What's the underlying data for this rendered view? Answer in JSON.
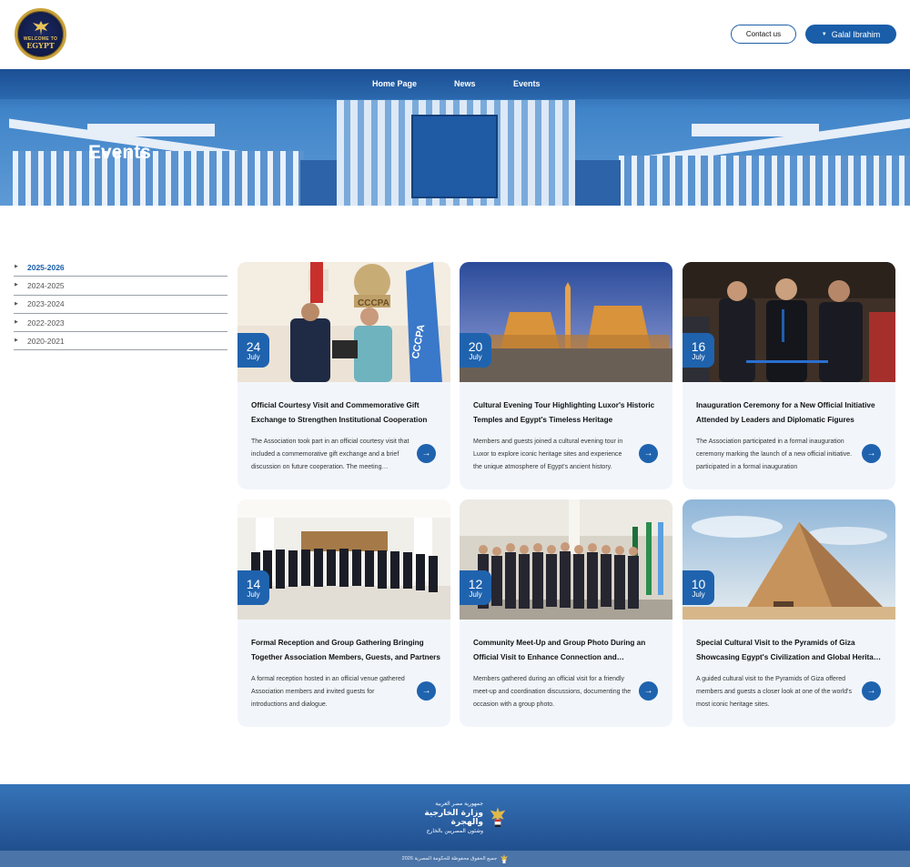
{
  "header": {
    "logo_line1": "WELCOME TO",
    "logo_line2": "EGYPT",
    "contact_label": "Contact us",
    "user_label": "Galal Ibrahim"
  },
  "nav": {
    "items": [
      {
        "label": "Home Page"
      },
      {
        "label": "News"
      },
      {
        "label": "Events"
      }
    ]
  },
  "hero": {
    "title": "Events"
  },
  "sidebar": {
    "items": [
      {
        "label": "2025-2026",
        "active": true
      },
      {
        "label": "2024-2025",
        "active": false
      },
      {
        "label": "2023-2024",
        "active": false
      },
      {
        "label": "2022-2023",
        "active": false
      },
      {
        "label": "2020-2021",
        "active": false
      }
    ]
  },
  "events": [
    {
      "day": "24",
      "month": "July",
      "title": "Official Courtesy Visit and Commemorative Gift Exchange to Strengthen Institutional Cooperation",
      "description": "The Association took part in an official courtesy visit that included a commemorative gift exchange and a brief discussion on future cooperation. The meeting highlighted",
      "image_sign": "CCCPA"
    },
    {
      "day": "20",
      "month": "July",
      "title": "Cultural Evening Tour Highlighting Luxor's Historic Temples and Egypt's Timeless Heritage",
      "description": "Members and guests joined a cultural evening tour in Luxor to explore iconic heritage sites and experience the unique atmosphere of Egypt's ancient history."
    },
    {
      "day": "16",
      "month": "July",
      "title": "Inauguration Ceremony for a New Official Initiative Attended by Leaders and Diplomatic Figures",
      "description": "The Association participated in a formal inauguration ceremony marking the launch of a new official initiative. participated in a formal inauguration"
    },
    {
      "day": "14",
      "month": "July",
      "title": "Formal Reception and Group Gathering Bringing Together Association Members, Guests, and Partners",
      "description": "A formal reception hosted in an official venue gathered Association members and invited guests for introductions and dialogue."
    },
    {
      "day": "12",
      "month": "July",
      "title": "Community Meet-Up and Group Photo During an Official Visit to Enhance Connection and Coordination",
      "description": "Members gathered during an official visit for a friendly meet-up and coordination discussions, documenting the occasion with a group photo."
    },
    {
      "day": "10",
      "month": "July",
      "title": "Special Cultural Visit to the Pyramids of Giza Showcasing Egypt's Civilization and Global Heritage Value",
      "description": "A guided cultural visit to the Pyramids of Giza offered members and guests a closer look at one of the world's most iconic heritage sites."
    }
  ],
  "footer": {
    "line1": "جمهورية مصر العربية",
    "line2": "وزارة الخارجية والهجرة",
    "line3": "وشئون المصريين بالخارج",
    "copyright": "جميع الحقوق محفوظة للحكومة المصرية 2026"
  },
  "colors": {
    "primary": "#1f63ae",
    "nav": "#1b4f93",
    "card_bg": "#f2f6fb"
  }
}
